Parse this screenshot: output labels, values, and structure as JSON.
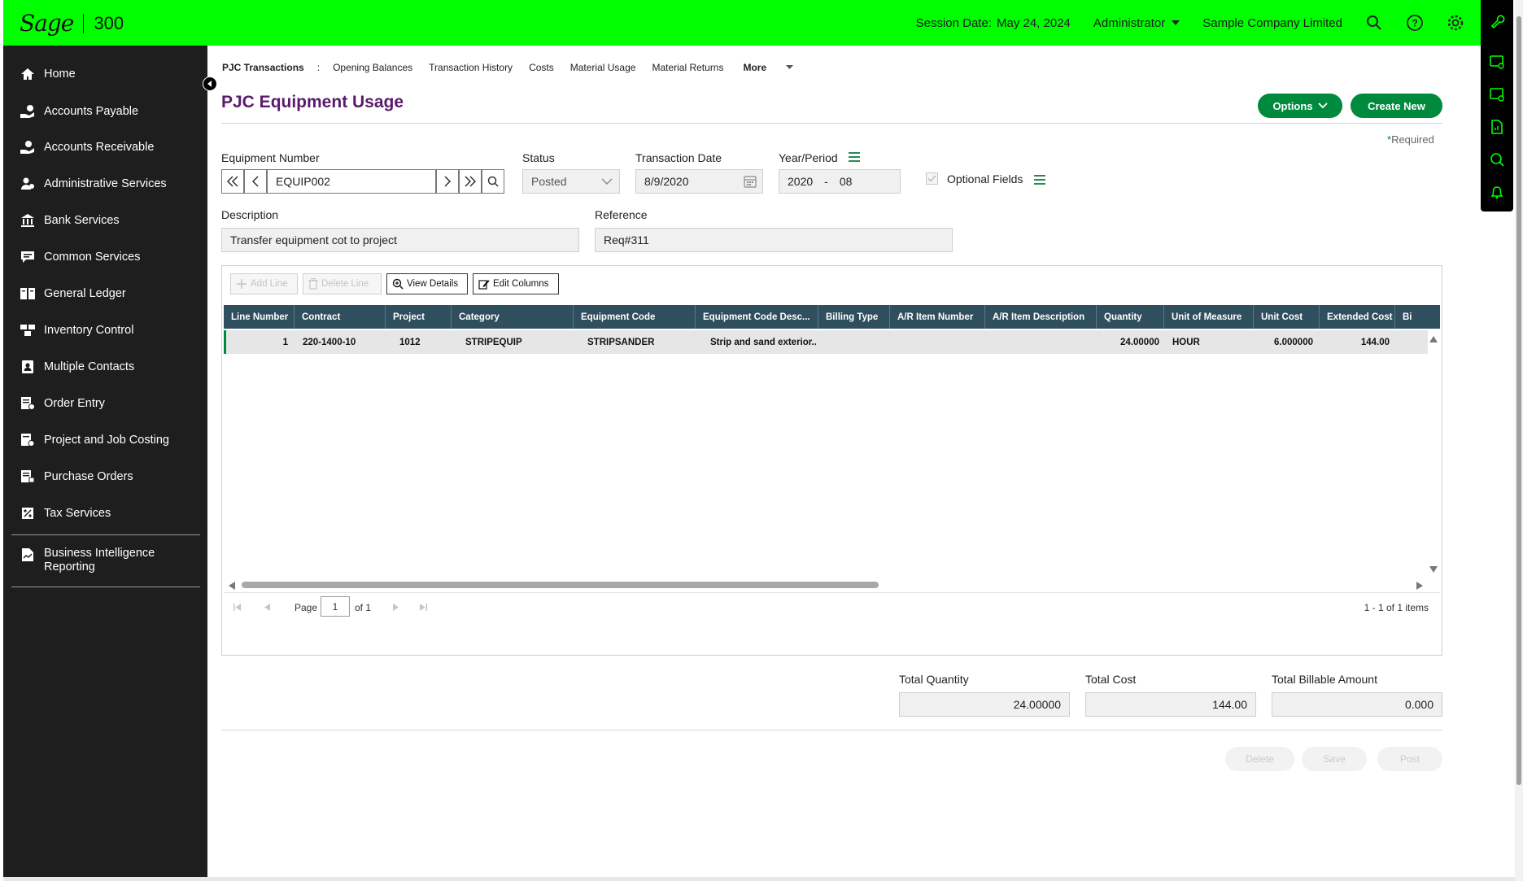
{
  "topbar": {
    "brand": "Sage",
    "product": "300",
    "session_label": "Session Date:",
    "session_date": "May 24, 2024",
    "user": "Administrator",
    "company": "Sample Company Limited"
  },
  "sidebar": {
    "items": [
      {
        "label": "Home"
      },
      {
        "label": "Accounts Payable"
      },
      {
        "label": "Accounts Receivable"
      },
      {
        "label": "Administrative Services"
      },
      {
        "label": "Bank Services"
      },
      {
        "label": "Common Services"
      },
      {
        "label": "General Ledger"
      },
      {
        "label": "Inventory Control"
      },
      {
        "label": "Multiple Contacts"
      },
      {
        "label": "Order Entry"
      },
      {
        "label": "Project and Job Costing"
      },
      {
        "label": "Purchase Orders"
      },
      {
        "label": "Tax Services"
      },
      {
        "label": "Business Intelligence Reporting"
      }
    ]
  },
  "subtabs": {
    "pjc": "PJC Transactions",
    "colon": ":",
    "opening": "Opening Balances",
    "history": "Transaction History",
    "costs": "Costs",
    "material_usage": "Material Usage",
    "material_returns": "Material Returns",
    "more": "More"
  },
  "page": {
    "title": "PJC Equipment Usage",
    "options_label": "Options",
    "create_new_label": "Create New",
    "required_label": "Required"
  },
  "form": {
    "equipment_number_label": "Equipment Number",
    "equipment_number": "EQUIP002",
    "status_label": "Status",
    "status": "Posted",
    "transaction_date_label": "Transaction Date",
    "transaction_date": "8/9/2020",
    "year_period_label": "Year/Period",
    "year": "2020",
    "dash": "-",
    "period": "08",
    "optional_fields_label": "Optional Fields",
    "description_label": "Description",
    "description": "Transfer equipment cot to project",
    "reference_label": "Reference",
    "reference": "Req#311"
  },
  "toolbar": {
    "add_line": "Add Line",
    "delete_line": "Delete Line",
    "view_details": "View Details",
    "edit_columns": "Edit Columns"
  },
  "grid": {
    "columns": [
      "Line Number",
      "Contract",
      "Project",
      "Category",
      "Equipment Code",
      "Equipment Code Desc...",
      "Billing Type",
      "A/R Item Number",
      "A/R Item Description",
      "Quantity",
      "Unit of Measure",
      "Unit Cost",
      "Extended Cost",
      "Bi"
    ],
    "rows": [
      {
        "line_number": "1",
        "contract": "220-1400-10",
        "project": "1012",
        "category": "STRIPEQUIP",
        "equipment_code": "STRIPSANDER",
        "equipment_code_desc": "Strip and sand exterior...",
        "billing_type": "",
        "ar_item_number": "",
        "ar_item_description": "",
        "quantity": "24.00000",
        "unit_of_measure": "HOUR",
        "unit_cost": "6.000000",
        "extended_cost": "144.00"
      }
    ]
  },
  "pager": {
    "page_label": "Page",
    "page_value": "1",
    "of_label": "of 1",
    "summary": "1 - 1 of 1 items"
  },
  "totals": {
    "quantity_label": "Total Quantity",
    "quantity": "24.00000",
    "cost_label": "Total Cost",
    "cost": "144.00",
    "billable_label": "Total Billable Amount",
    "billable": "0.000"
  },
  "actions": {
    "delete": "Delete",
    "save": "Save",
    "post": "Post"
  },
  "colors": {
    "topbar": "#00ff00",
    "sidebar": "#1e1e1e",
    "accent": "#008a3e",
    "title": "#5b1a6b",
    "grid_header": "#2f4f5f"
  }
}
